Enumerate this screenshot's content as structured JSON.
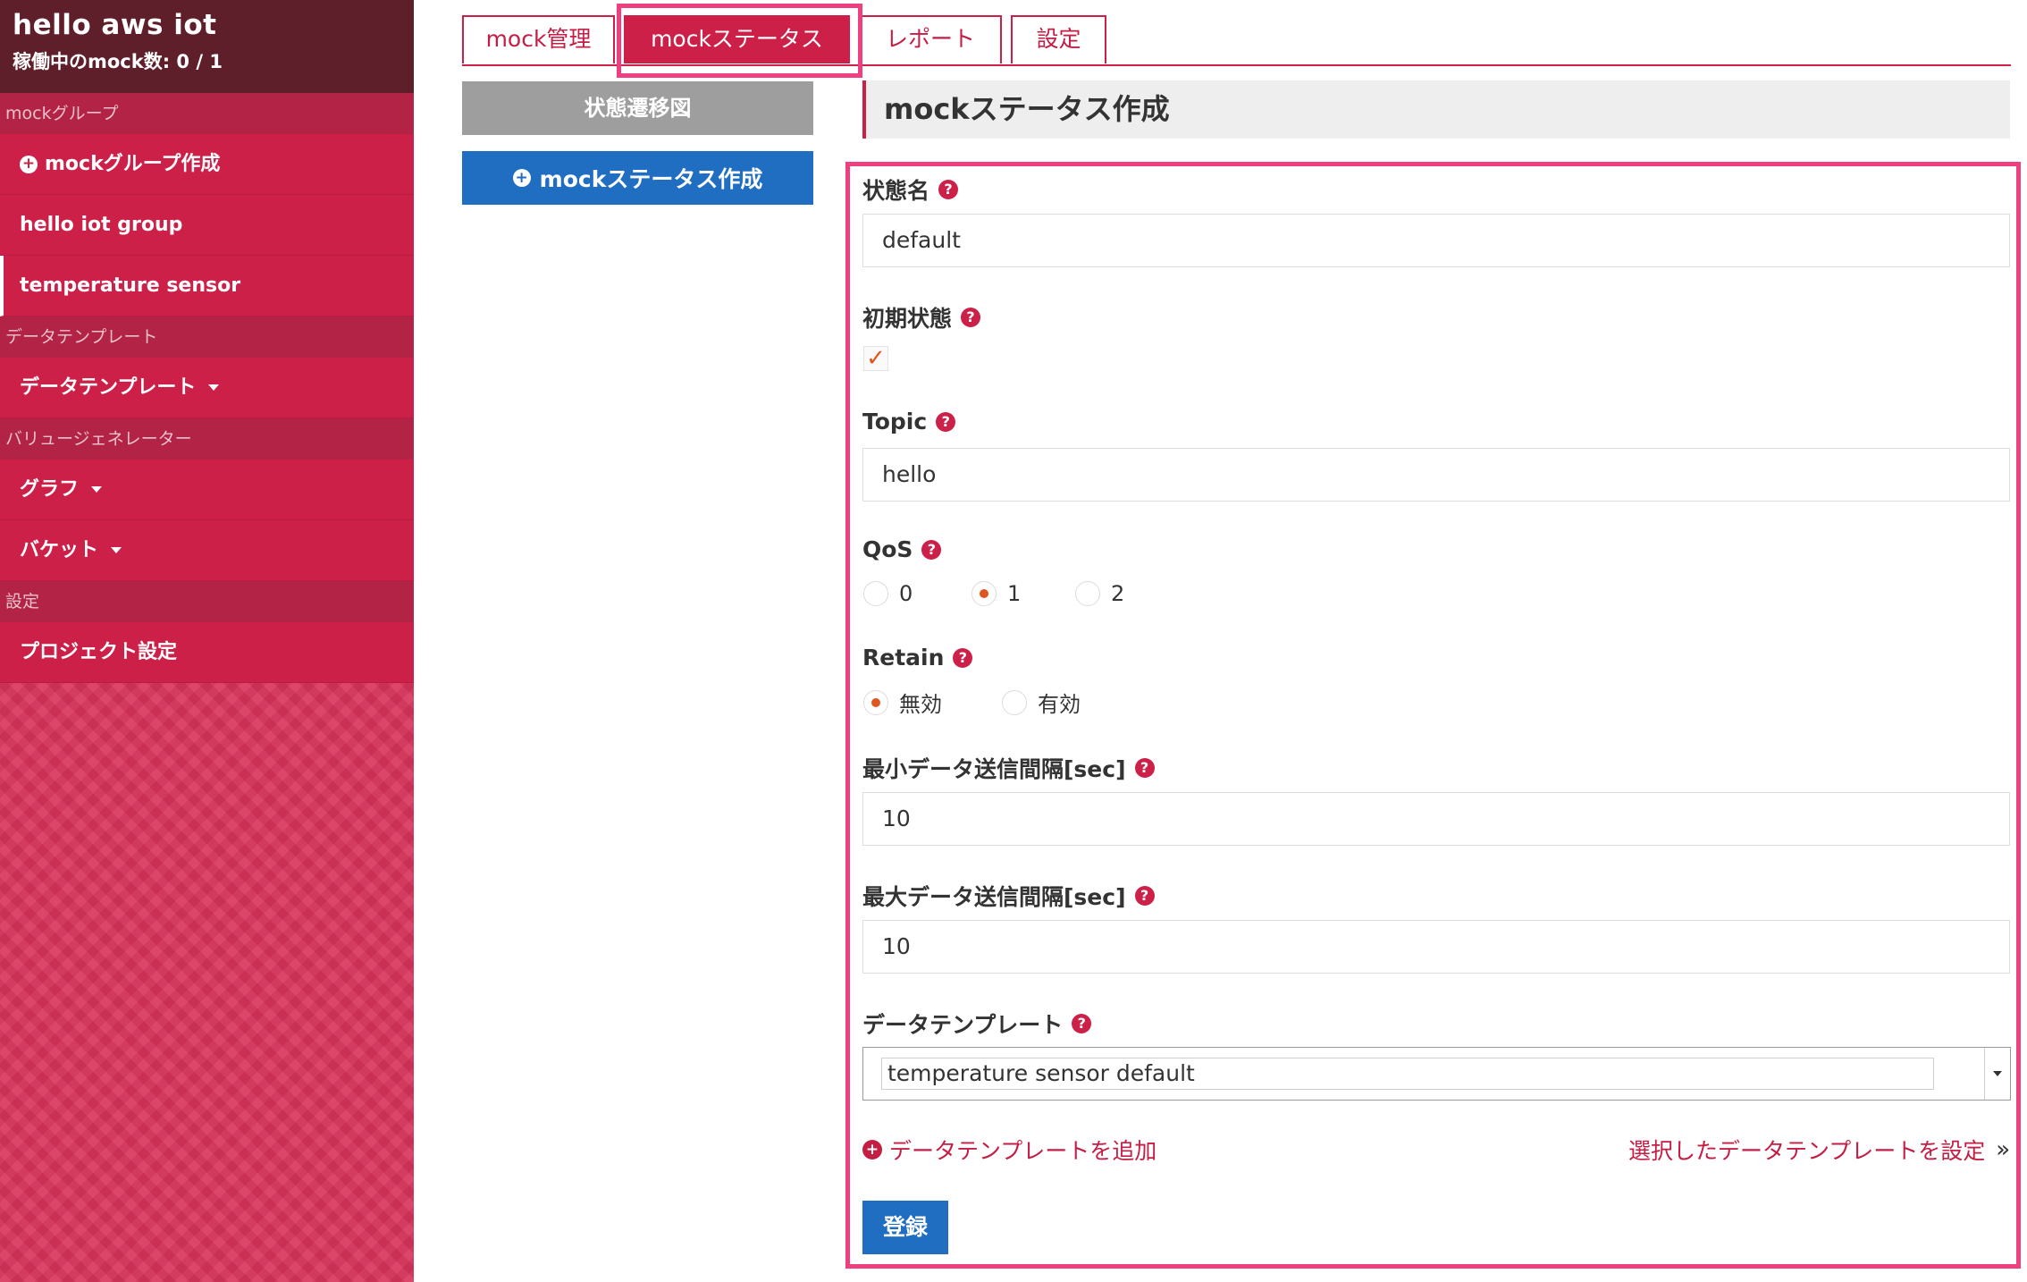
{
  "app": {
    "title": "hello aws iot",
    "running_mocks": "稼働中のmock数: 0 / 1"
  },
  "sidebar": {
    "sections": [
      {
        "label": "mockグループ"
      },
      {
        "label": "データテンプレート"
      },
      {
        "label": "バリュージェネレーター"
      },
      {
        "label": "設定"
      }
    ],
    "items": [
      {
        "label": "mockグループ作成",
        "icon": "plus-circle-icon"
      },
      {
        "label": "hello iot group"
      },
      {
        "label": "temperature sensor",
        "active": true
      },
      {
        "label": "データテンプレート",
        "dropdown": true
      },
      {
        "label": "グラフ",
        "dropdown": true
      },
      {
        "label": "バケット",
        "dropdown": true
      },
      {
        "label": "プロジェクト設定"
      }
    ]
  },
  "tabs": [
    {
      "label": "mock管理"
    },
    {
      "label": "mockステータス",
      "active": true
    },
    {
      "label": "レポート"
    },
    {
      "label": "設定"
    }
  ],
  "side_buttons": {
    "state_diagram": "状態遷移図",
    "create_status": "mockステータス作成"
  },
  "main": {
    "heading": "mockステータス作成"
  },
  "form": {
    "state_name": {
      "label": "状態名",
      "value": "default"
    },
    "initial_state": {
      "label": "初期状態",
      "checked": true
    },
    "topic": {
      "label": "Topic",
      "value": "hello"
    },
    "qos": {
      "label": "QoS",
      "options": [
        "0",
        "1",
        "2"
      ],
      "selected": "1"
    },
    "retain": {
      "label": "Retain",
      "options": [
        "無効",
        "有効"
      ],
      "selected": "無効"
    },
    "min_interval": {
      "label": "最小データ送信間隔[sec]",
      "value": "10"
    },
    "max_interval": {
      "label": "最大データ送信間隔[sec]",
      "value": "10"
    },
    "data_template": {
      "label": "データテンプレート",
      "value": "temperature sensor default"
    },
    "add_template_link": "データテンプレートを追加",
    "set_template_link": "選択したデータテンプレートを設定",
    "submit_label": "登録"
  },
  "colors": {
    "brand": "#cd2049",
    "primary_button": "#1f6ec1",
    "highlight": "#ef3f80",
    "checkmark": "#e0561f"
  }
}
